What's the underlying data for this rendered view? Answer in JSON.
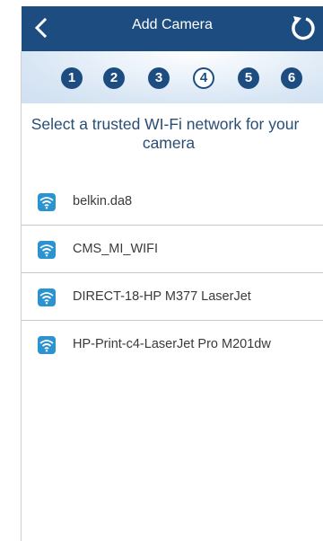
{
  "header": {
    "title": "Add Camera",
    "bg_color": "#1d4d80"
  },
  "steps": [
    "1",
    "2",
    "3",
    "4",
    "5",
    "6"
  ],
  "active_step": 4,
  "instruction": {
    "line1": "Select a trusted WI-Fi network for your",
    "line2": "camera"
  },
  "networks": [
    {
      "ssid": "belkin.da8"
    },
    {
      "ssid": "CMS_MI_WIFI"
    },
    {
      "ssid": "DIRECT-18-HP M377 LaserJet"
    },
    {
      "ssid": "HP-Print-c4-LaserJet Pro M201dw"
    }
  ],
  "colors": {
    "accent": "#2c93d1",
    "text_heading": "#2a4d74"
  }
}
